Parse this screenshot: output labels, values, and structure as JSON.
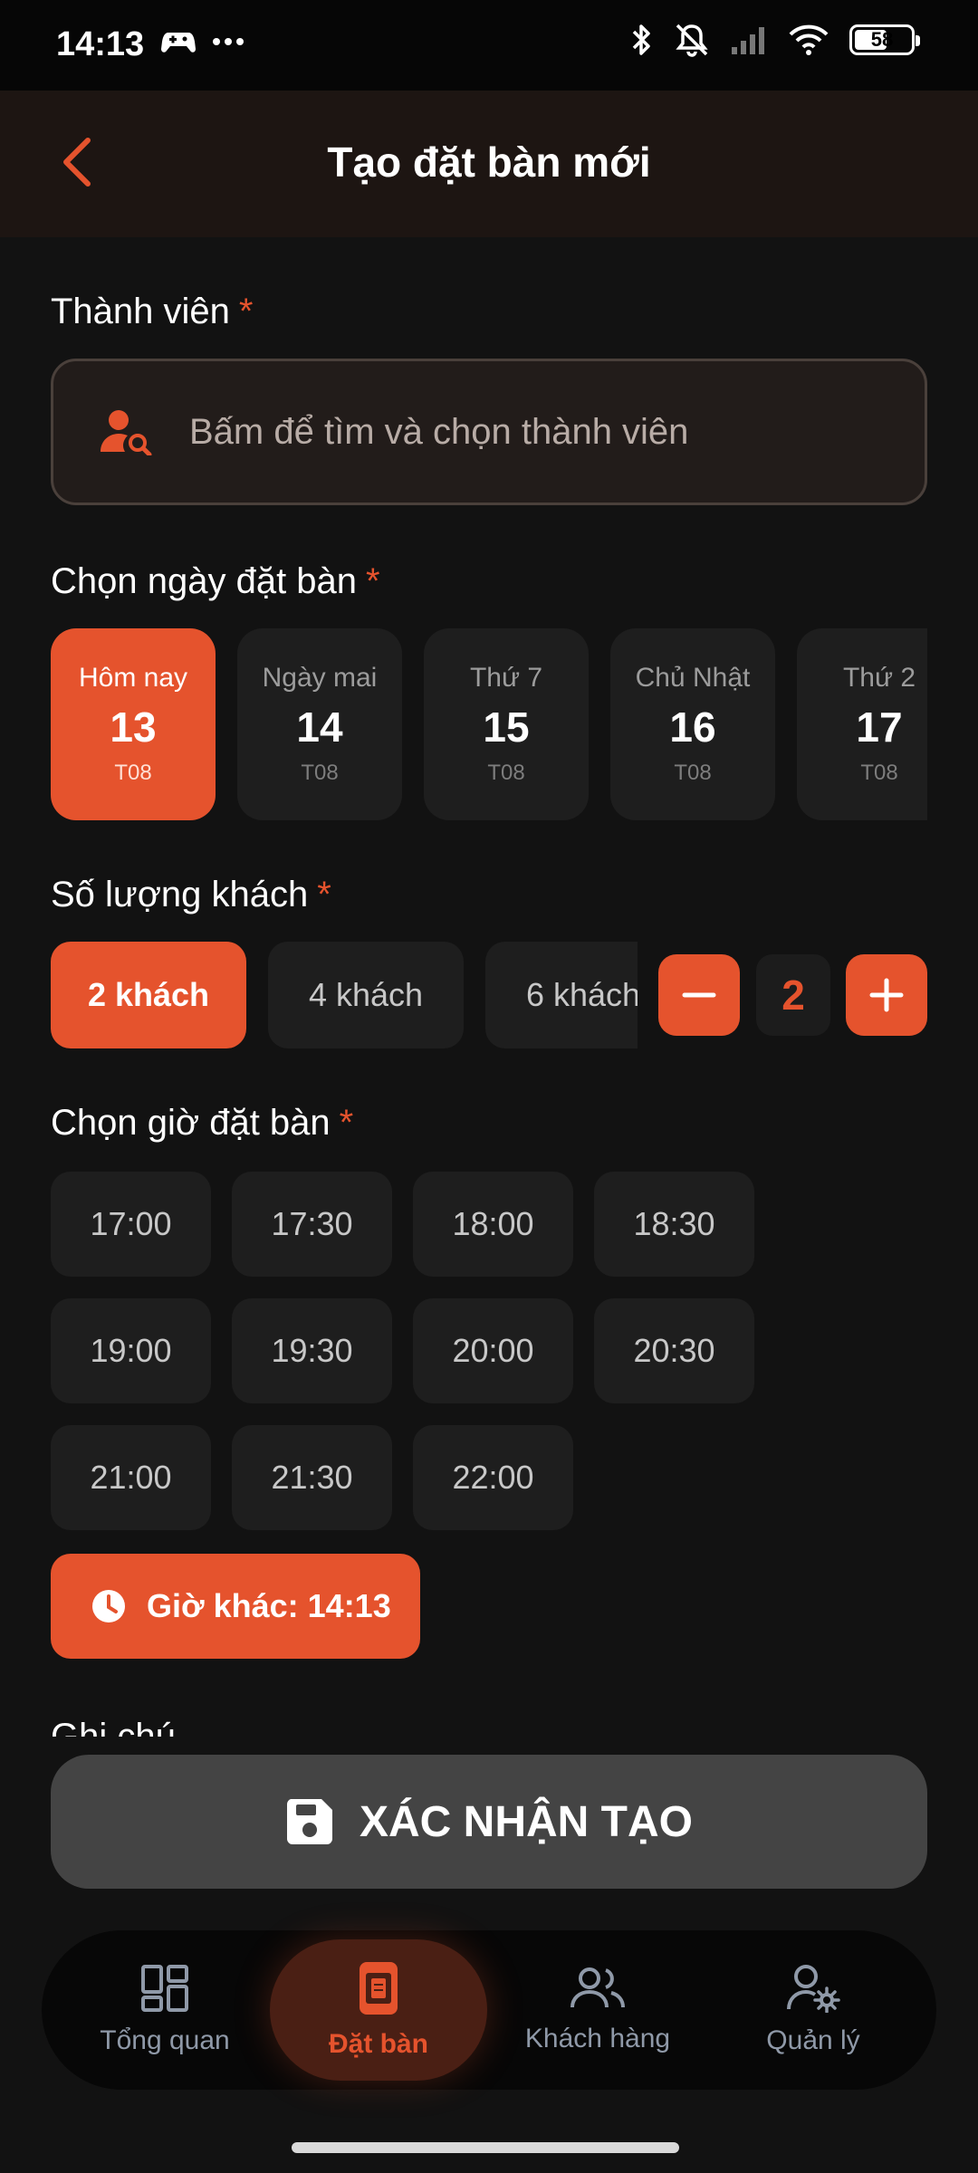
{
  "status_bar": {
    "time": "14:13",
    "battery": "58",
    "battery_level": 0.58
  },
  "header": {
    "title": "Tạo đặt bàn mới"
  },
  "member": {
    "label": "Thành viên",
    "required_mark": "*",
    "placeholder": "Bấm để tìm và chọn thành viên"
  },
  "date": {
    "label": "Chọn ngày đặt bàn",
    "required_mark": "*",
    "items": [
      {
        "name": "Hôm nay",
        "day": "13",
        "month": "T08"
      },
      {
        "name": "Ngày mai",
        "day": "14",
        "month": "T08"
      },
      {
        "name": "Thứ 7",
        "day": "15",
        "month": "T08"
      },
      {
        "name": "Chủ Nhật",
        "day": "16",
        "month": "T08"
      },
      {
        "name": "Thứ 2",
        "day": "17",
        "month": "T08"
      }
    ]
  },
  "guests": {
    "label": "Số lượng khách",
    "required_mark": "*",
    "options": [
      "2 khách",
      "4 khách",
      "6 khách"
    ],
    "count": "2"
  },
  "time": {
    "label": "Chọn giờ đặt bàn",
    "required_mark": "*",
    "slots": [
      "17:00",
      "17:30",
      "18:00",
      "18:30",
      "19:00",
      "19:30",
      "20:00",
      "20:30",
      "21:00",
      "21:30",
      "22:00"
    ],
    "other_label": "Giờ khác: 14:13"
  },
  "note": {
    "label": "Ghi chú"
  },
  "confirm": {
    "label": "XÁC NHẬN TẠO"
  },
  "nav": {
    "items": [
      {
        "label": "Tổng quan"
      },
      {
        "label": "Đặt bàn"
      },
      {
        "label": "Khách hàng"
      },
      {
        "label": "Quản lý"
      }
    ]
  },
  "colors": {
    "accent": "#e5532d",
    "background": "#121212",
    "chip": "#1e1e1e"
  }
}
